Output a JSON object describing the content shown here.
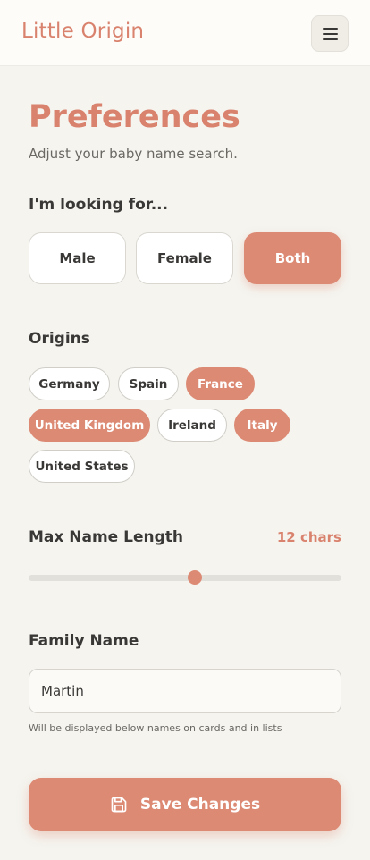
{
  "header": {
    "brand": "Little Origin",
    "menu_icon": "hamburger-menu-icon"
  },
  "page": {
    "title": "Preferences",
    "subtitle": "Adjust your baby name search."
  },
  "gender": {
    "label": "I'm looking for...",
    "options": [
      "Male",
      "Female",
      "Both"
    ],
    "selected": "Both"
  },
  "origins": {
    "label": "Origins",
    "chips": [
      {
        "label": "Germany",
        "selected": false
      },
      {
        "label": "Spain",
        "selected": false
      },
      {
        "label": "France",
        "selected": true
      },
      {
        "label": "United Kingdom",
        "selected": true
      },
      {
        "label": "Ireland",
        "selected": false
      },
      {
        "label": "Italy",
        "selected": true
      },
      {
        "label": "United States",
        "selected": false
      }
    ]
  },
  "length": {
    "label": "Max Name Length",
    "value_text": "12 chars",
    "value_fraction": 0.53
  },
  "family": {
    "label": "Family Name",
    "value": "Martin",
    "helper": "Will be displayed below names on cards and in lists"
  },
  "save": {
    "label": "Save Changes",
    "icon": "save-icon"
  },
  "colors": {
    "accent": "#dc8a74",
    "background": "#f5f4ef"
  }
}
